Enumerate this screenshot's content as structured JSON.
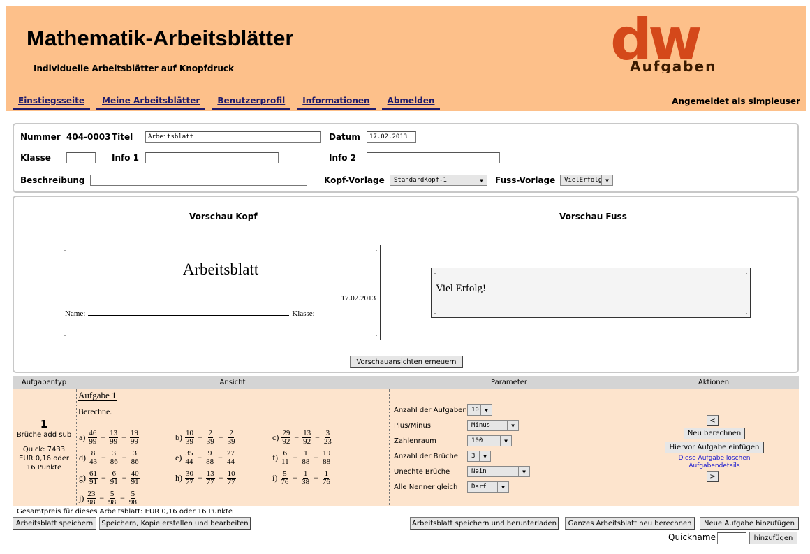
{
  "header": {
    "title": "Mathematik-Arbeitsblätter",
    "subtitle": "Individuelle Arbeitsblätter auf Knopfdruck",
    "logo_text_big": "dw",
    "logo_text_small": "Aufgaben",
    "nav": [
      "Einstiegsseite",
      "Meine Arbeitsblätter",
      "Benutzerprofil",
      "Informationen",
      "Abmelden"
    ],
    "login_status": "Angemeldet als simpleuser",
    "colors": {
      "background": "#fdc08a",
      "nav": "#1e1a6b",
      "logo": "#d4481a"
    }
  },
  "meta": {
    "nummer_label": "Nummer",
    "nummer_value": "404-0003",
    "titel_label": "Titel",
    "titel_value": "Arbeitsblatt",
    "datum_label": "Datum",
    "datum_value": "17.02.2013",
    "klasse_label": "Klasse",
    "klasse_value": "",
    "info1_label": "Info 1",
    "info1_value": "",
    "info2_label": "Info 2",
    "info2_value": "",
    "beschreibung_label": "Beschreibung",
    "beschreibung_value": "",
    "kopf_label": "Kopf-Vorlage",
    "kopf_value": "StandardKopf-1",
    "fuss_label": "Fuss-Vorlage",
    "fuss_value": "VielErfolg"
  },
  "preview": {
    "kopf_heading": "Vorschau Kopf",
    "fuss_heading": "Vorschau Fuss",
    "kopf_title": "Arbeitsblatt",
    "kopf_date": "17.02.2013",
    "kopf_name_label": "Name:",
    "kopf_klasse_label": "Klasse:",
    "fuss_text": "Viel Erfolg!",
    "refresh_button": "Vorschauansichten erneuern"
  },
  "table": {
    "headers": [
      "Aufgabentyp",
      "Ansicht",
      "Parameter",
      "Aktionen"
    ],
    "task": {
      "number": "1",
      "type": "Brüche add sub",
      "quick": "Quick: 7433",
      "price": "EUR 0,16 oder",
      "points": "16 Punkte"
    },
    "view": {
      "title": "Aufgabe 1",
      "instruction": "Berechne.",
      "problems": [
        {
          "label": "a)",
          "terms": [
            [
              "46",
              "99"
            ],
            [
              "13",
              "99"
            ],
            [
              "19",
              "99"
            ]
          ]
        },
        {
          "label": "b)",
          "terms": [
            [
              "10",
              "39"
            ],
            [
              "2",
              "39"
            ],
            [
              "2",
              "39"
            ]
          ]
        },
        {
          "label": "c)",
          "terms": [
            [
              "29",
              "92"
            ],
            [
              "13",
              "92"
            ],
            [
              "3",
              "23"
            ]
          ]
        },
        {
          "label": "d)",
          "terms": [
            [
              "8",
              "43"
            ],
            [
              "3",
              "86"
            ],
            [
              "3",
              "86"
            ]
          ]
        },
        {
          "label": "e)",
          "terms": [
            [
              "35",
              "44"
            ],
            [
              "9",
              "88"
            ],
            [
              "27",
              "44"
            ]
          ]
        },
        {
          "label": "f)",
          "terms": [
            [
              "6",
              "11"
            ],
            [
              "1",
              "88"
            ],
            [
              "19",
              "88"
            ]
          ]
        },
        {
          "label": "g)",
          "terms": [
            [
              "61",
              "91"
            ],
            [
              "6",
              "91"
            ],
            [
              "40",
              "91"
            ]
          ]
        },
        {
          "label": "h)",
          "terms": [
            [
              "30",
              "77"
            ],
            [
              "13",
              "77"
            ],
            [
              "10",
              "77"
            ]
          ]
        },
        {
          "label": "i)",
          "terms": [
            [
              "5",
              "76"
            ],
            [
              "1",
              "38"
            ],
            [
              "1",
              "76"
            ]
          ]
        },
        {
          "label": "j)",
          "terms": [
            [
              "23",
              "98"
            ],
            [
              "5",
              "98"
            ],
            [
              "5",
              "98"
            ]
          ]
        }
      ],
      "operator": "−"
    },
    "params": [
      {
        "label": "Anzahl der Aufgaben",
        "value": "10"
      },
      {
        "label": "Plus/Minus",
        "value": "Minus"
      },
      {
        "label": "Zahlenraum",
        "value": "100"
      },
      {
        "label": "Anzahl der Brüche",
        "value": "3"
      },
      {
        "label": "Unechte Brüche",
        "value": "Nein"
      },
      {
        "label": "Alle Nenner gleich",
        "value": "Darf"
      }
    ],
    "actions": {
      "up": "<",
      "recalc": "Neu berechnen",
      "insert_before": "Hiervor Aufgabe einfügen",
      "delete_link": "Diese Aufgabe löschen",
      "details_link": "Aufgabendetails",
      "down": ">"
    }
  },
  "footer": {
    "total_price": "Gesamtpreis für dieses Arbeitsblatt: EUR 0,16 oder 16 Punkte",
    "save": "Arbeitsblatt speichern",
    "save_copy": "Speichern, Kopie erstellen und bearbeiten",
    "save_download": "Arbeitsblatt speichern und herunterladen",
    "recalc_all": "Ganzes Arbeitsblatt neu berechnen",
    "add_task": "Neue Aufgabe hinzufügen",
    "quickname_label": "Quickname",
    "quickname_value": "",
    "add": "hinzufügen"
  }
}
